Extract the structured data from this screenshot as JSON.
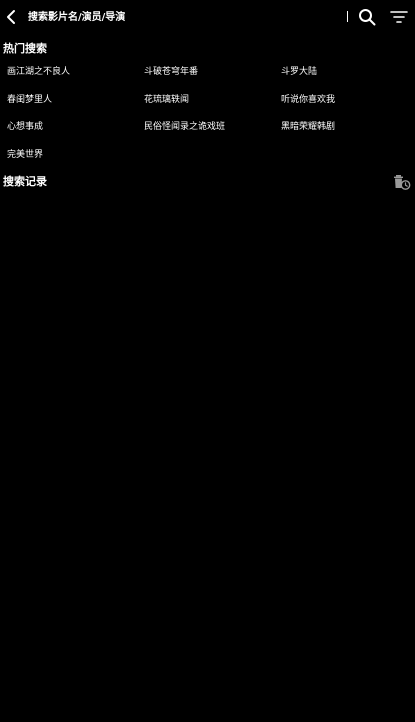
{
  "header": {
    "search_placeholder": "搜索影片名/演员/导演",
    "back_icon": "back-arrow-icon",
    "search_icon": "search-icon",
    "filter_icon": "filter-icon"
  },
  "hot_search": {
    "title": "热门搜索",
    "items": [
      "画江湖之不良人",
      "斗破苍穹年番",
      "斗罗大陆",
      "春闺梦里人",
      "花琉璃轶闻",
      "听说你喜欢我",
      "心想事成",
      "民俗怪闻录之诡戏班",
      "黑暗荣耀韩剧",
      "完美世界"
    ]
  },
  "history": {
    "title": "搜索记录",
    "clear_icon": "clear-history-icon"
  },
  "colors": {
    "background": "#000000",
    "text": "#ffffff",
    "icon_gray": "#9a9a9a"
  }
}
